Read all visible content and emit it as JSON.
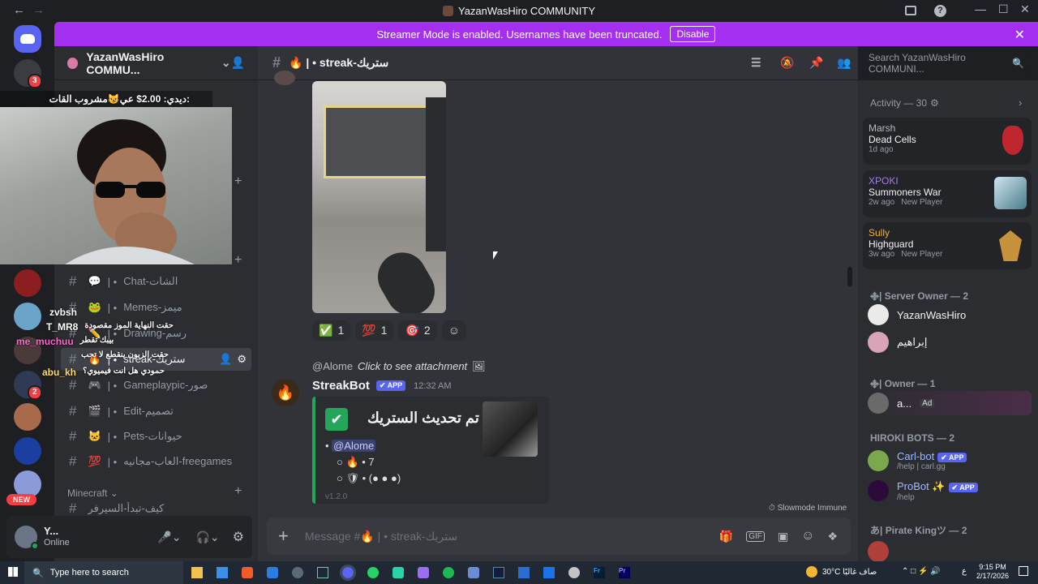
{
  "window": {
    "title": "YazanWasHiro COMMUNITY"
  },
  "banner": {
    "text": "Streamer Mode is enabled. Usernames have been truncated.",
    "button": "Disable"
  },
  "rail": {
    "badge_top": "3",
    "badge_mid": "2",
    "new_label": "NEW"
  },
  "server": {
    "name": "YazanWasHiro COMMU..."
  },
  "overlay": {
    "stream_title": "ديدي: 2.00$ عي😼مشروب القات:",
    "chat": [
      {
        "user": "zvbsh",
        "text": ""
      },
      {
        "user": "T_MR8",
        "text": "حقت النهاية الموز مقصودة"
      },
      {
        "user": "me_muchuu",
        "text": "بيبك تقطر"
      },
      {
        "user": "",
        "text": "حقت الزبون ينقطع لا تجب"
      },
      {
        "user": "abu_kh",
        "text": "حمودي هل انت فيميوي؟"
      }
    ]
  },
  "channels": [
    {
      "icon": "💬",
      "label": "Chat-الشات"
    },
    {
      "icon": "🐸",
      "label": "Memes-ميمز"
    },
    {
      "icon": "✏️",
      "label": "Drawing-رسم"
    },
    {
      "icon": "🔥",
      "label": "streak-ستريك"
    },
    {
      "icon": "🎮",
      "label": "Gameplaypic-صور"
    },
    {
      "icon": "🎬",
      "label": "Edit-تصميم"
    },
    {
      "icon": "🐱",
      "label": "Pets-حيوانات"
    },
    {
      "icon": "💯",
      "label": "العاب-مجانيه-freegames"
    }
  ],
  "category": {
    "name": "Minecraft",
    "partial_channel": "كيف-تبدأ-السيرفر"
  },
  "user": {
    "name": "Y...",
    "status": "Online"
  },
  "chat_header": {
    "channel": "🔥 | • streak-ستريك"
  },
  "search": {
    "placeholder": "Search YazanWasHiro COMMUNI..."
  },
  "reactions": [
    {
      "emoji": "✅",
      "count": "1"
    },
    {
      "emoji": "💯",
      "count": "1"
    },
    {
      "emoji": "🎯",
      "count": "2"
    }
  ],
  "message": {
    "reply_user": "@Alome",
    "reply_text": "Click to see attachment",
    "author": "StreakBot",
    "app_tag": "✔ APP",
    "time": "12:32 AM",
    "embed_title": "تم تحديث الستريك •",
    "mention": "@Alome",
    "line1": "• 7",
    "line2": "• (● ● ●)",
    "version": "v1.2.0",
    "slowmode": "Slowmode Immune"
  },
  "composer": {
    "placeholder": "Message #🔥 | • streak-ستريك"
  },
  "activity": {
    "header": "Activity — 30",
    "cards": [
      {
        "user": "Marsh",
        "game": "Dead Cells",
        "meta": "1d ago",
        "extra": ""
      },
      {
        "user": "XPOKI",
        "game": "Summoners War",
        "meta": "2w ago",
        "extra": "New Player"
      },
      {
        "user": "Sully",
        "game": "Highguard",
        "meta": "3w ago",
        "extra": "New Player"
      }
    ]
  },
  "members": {
    "server_owner_header": "࿇| Server Owner — 2",
    "server_owners": [
      "YazanWasHiro",
      "إبراهيم"
    ],
    "owner_header": "࿇| Owner — 1",
    "owners": [
      {
        "name": "a...",
        "badge": "Ad"
      }
    ],
    "bots_header": "HIROKI BOTS — 2",
    "bots": [
      {
        "name": "Carl-bot",
        "tag": "✔ APP",
        "sub": "/help | carl.gg"
      },
      {
        "name": "ProBot ✨",
        "tag": "✔ APP",
        "sub": "/help"
      }
    ],
    "pirate_header": "あ| Pirate Kingツ — 2"
  },
  "taskbar": {
    "search_placeholder": "Type here to search",
    "weather": "30°C صاف غالبًا",
    "time": "9:15 PM",
    "date": "2/17/2026",
    "lang": "ع"
  },
  "colors": {
    "accent": "#5865f2",
    "banner": "#a42ff0",
    "online": "#23a55a",
    "danger": "#f23f43"
  }
}
